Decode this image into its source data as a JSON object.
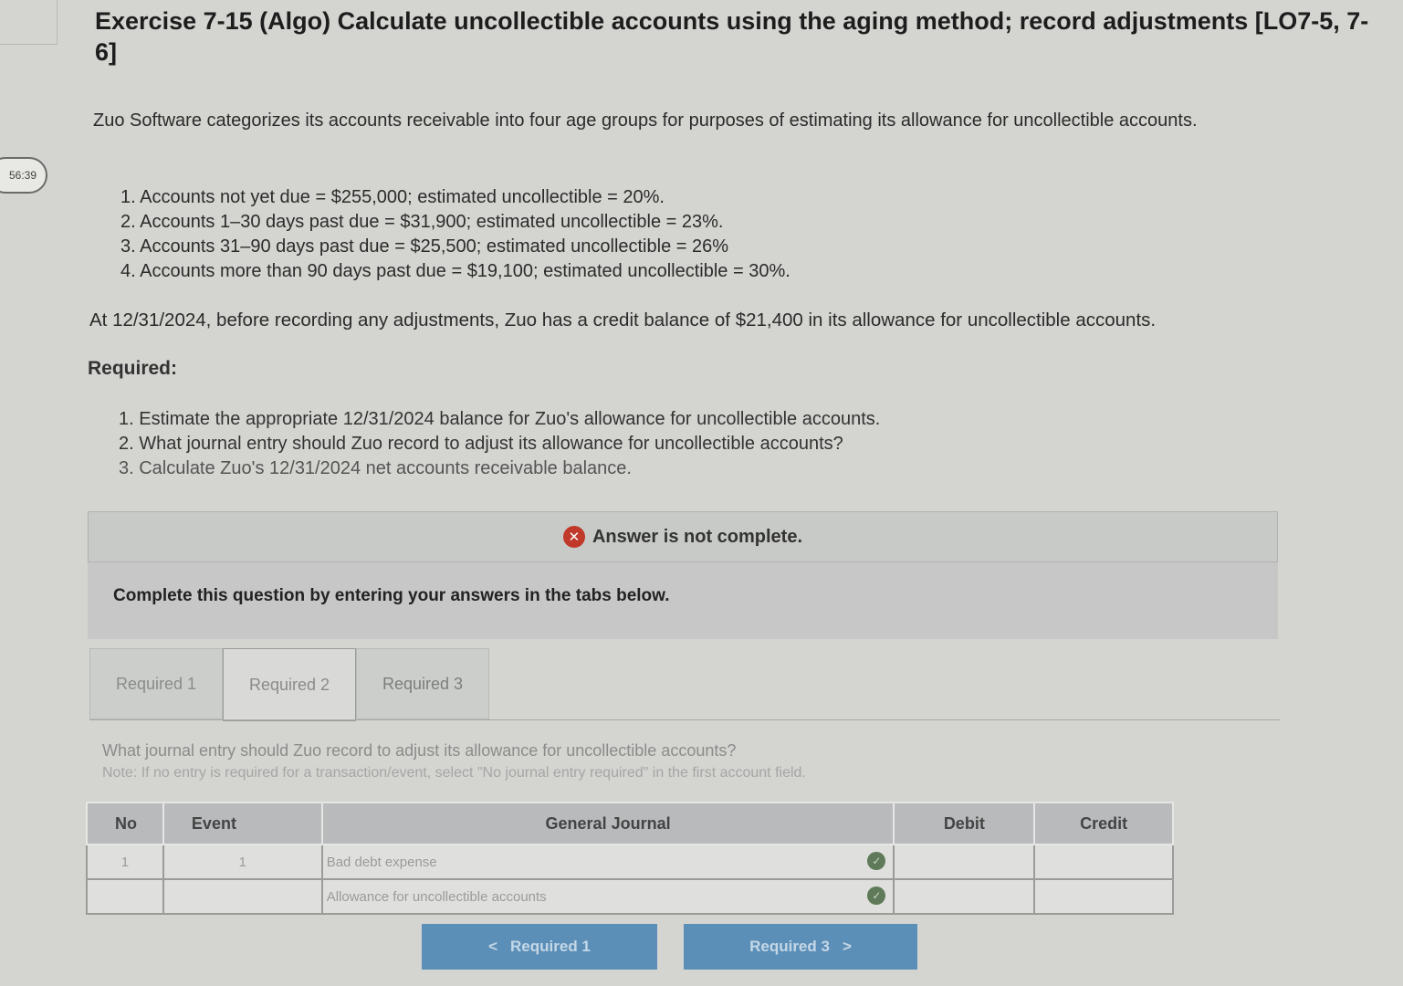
{
  "timer": "56:39",
  "title": "Exercise 7-15 (Algo) Calculate uncollectible accounts using the aging method; record adjustments [LO7-5, 7-6]",
  "intro": "Zuo Software categorizes its accounts receivable into four age groups for purposes of estimating its allowance for uncollectible accounts.",
  "age_groups": [
    "1. Accounts not yet due = $255,000; estimated uncollectible = 20%.",
    "2. Accounts 1–30 days past due = $31,900; estimated uncollectible = 23%.",
    "3. Accounts 31–90 days past due = $25,500; estimated uncollectible = 26%",
    "4. Accounts more than 90 days past due = $19,100; estimated uncollectible = 30%."
  ],
  "balance_text": "At 12/31/2024, before recording any adjustments, Zuo has a credit balance of $21,400 in its allowance for uncollectible accounts.",
  "required_label": "Required:",
  "required_items": [
    "1. Estimate the appropriate 12/31/2024 balance for Zuo's allowance for uncollectible accounts.",
    "2. What journal entry should Zuo record to adjust its allowance for uncollectible accounts?",
    "3. Calculate Zuo's 12/31/2024 net accounts receivable balance."
  ],
  "banner": {
    "icon": "x-circle-icon",
    "text": "Answer is not complete."
  },
  "complete_text": "Complete this question by entering your answers in the tabs below.",
  "tabs": [
    "Required 1",
    "Required 2",
    "Required 3"
  ],
  "active_tab": "Required 2",
  "question": "What journal entry should Zuo record to adjust its allowance for uncollectible accounts?",
  "note": "Note: If no entry is required for a transaction/event, select \"No journal entry required\" in the first account field.",
  "journal": {
    "headers": [
      "No",
      "Event",
      "General Journal",
      "Debit",
      "Credit"
    ],
    "rows": [
      {
        "no": "1",
        "event": "1",
        "account": "Bad debt expense",
        "debit": "",
        "credit": ""
      },
      {
        "no": "",
        "event": "",
        "account": "Allowance for uncollectible accounts",
        "debit": "",
        "credit": ""
      }
    ]
  },
  "nav": {
    "prev": "Required 1",
    "next": "Required 3"
  },
  "colors": {
    "error": "#c0392b",
    "button": "#5c8fb8",
    "check": "#5f7a58"
  }
}
